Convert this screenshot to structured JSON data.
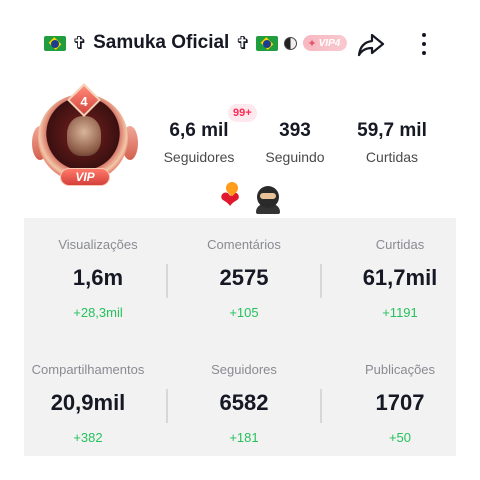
{
  "profile": {
    "name": "Samuka Oficial",
    "name_prefix_icons": [
      "brazil-flag-icon",
      "cross-icon"
    ],
    "name_suffix_icons": [
      "cross-icon",
      "brazil-flag-icon",
      "yinyang-icon"
    ],
    "cross_glyph": "✞",
    "vip_badge": "VIP4",
    "avatar_level": "4",
    "avatar_ribbon": "VIP",
    "notification_badge": "99+"
  },
  "header_stats": [
    {
      "value": "6,6 mil",
      "label": "Seguidores"
    },
    {
      "value": "393",
      "label": "Seguindo"
    },
    {
      "value": "59,7 mil",
      "label": "Curtidas"
    }
  ],
  "bio_emojis": [
    "heart-on-fire-icon",
    "ninja-icon"
  ],
  "analytics": [
    {
      "label": "Visualizações",
      "value": "1,6m",
      "delta": "+28,3mil"
    },
    {
      "label": "Comentários",
      "value": "2575",
      "delta": "+105"
    },
    {
      "label": "Curtidas",
      "value": "61,7mil",
      "delta": "+1191"
    },
    {
      "label": "Compartilhamentos",
      "value": "20,9mil",
      "delta": "+382"
    },
    {
      "label": "Seguidores",
      "value": "6582",
      "delta": "+181"
    },
    {
      "label": "Publicações",
      "value": "1707",
      "delta": "+50"
    }
  ],
  "colors": {
    "delta_green": "#25c25a",
    "notification_red": "#fe2c55",
    "panel_bg": "#f2f2f3"
  }
}
